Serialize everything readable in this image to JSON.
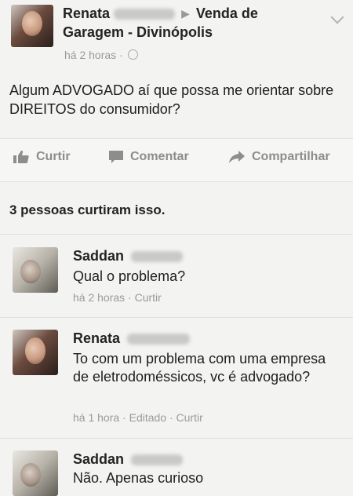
{
  "post": {
    "author_first": "Renata",
    "group_line1": "Venda de",
    "group_line2": "Garagem - Divinópolis",
    "timestamp": "há 2 horas ·",
    "text": "Algum ADVOGADO aí que possa me orientar sobre DIREITOS do consumidor?"
  },
  "actions": {
    "like": "Curtir",
    "comment": "Comentar",
    "share": "Compartilhar"
  },
  "likes_summary": "3 pessoas curtiram isso.",
  "comments": [
    {
      "name": "Saddan",
      "text": "Qual o problema?",
      "meta": "há 2 horas · Curtir"
    },
    {
      "name": "Renata",
      "text": "To com um problema com uma empresa de eletrodoméssicos, vc é advogado?",
      "meta": "há 1 hora · Editado · Curtir"
    },
    {
      "name": "Saddan",
      "text": "Não. Apenas curioso",
      "meta": ""
    }
  ],
  "icons": {
    "like": "thumbs-up-icon",
    "comment": "speech-bubble-icon",
    "share": "share-arrow-icon",
    "audience": "globe-icon",
    "menu": "chevron-down-icon"
  },
  "colors": {
    "background": "#f3f3f1",
    "text": "#1e1e1e",
    "muted": "#9a9a9a"
  }
}
